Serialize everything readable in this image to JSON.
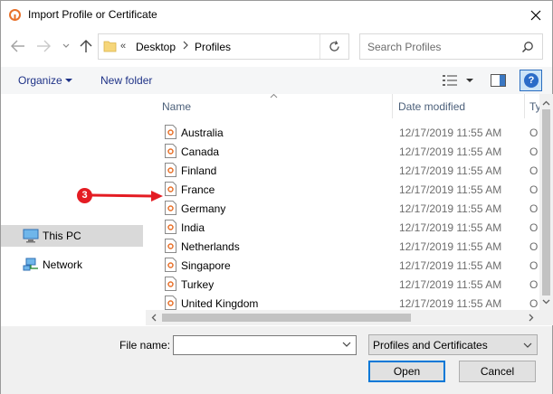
{
  "window": {
    "title": "Import Profile or Certificate"
  },
  "address": {
    "chevron": "«",
    "crumbs": [
      "Desktop",
      "Profiles"
    ]
  },
  "search": {
    "placeholder": "Search Profiles"
  },
  "toolbar": {
    "organize_label": "Organize",
    "new_folder_label": "New folder",
    "help_label": "?"
  },
  "nav": {
    "items": [
      {
        "label": "This PC",
        "selected": true
      },
      {
        "label": "Network",
        "selected": false
      }
    ]
  },
  "columns": {
    "name": "Name",
    "date": "Date modified",
    "type": "Ty"
  },
  "files": [
    {
      "name": "Australia",
      "date": "12/17/2019 11:55 AM",
      "type": "O"
    },
    {
      "name": "Canada",
      "date": "12/17/2019 11:55 AM",
      "type": "O"
    },
    {
      "name": "Finland",
      "date": "12/17/2019 11:55 AM",
      "type": "O"
    },
    {
      "name": "France",
      "date": "12/17/2019 11:55 AM",
      "type": "O"
    },
    {
      "name": "Germany",
      "date": "12/17/2019 11:55 AM",
      "type": "O"
    },
    {
      "name": "India",
      "date": "12/17/2019 11:55 AM",
      "type": "O"
    },
    {
      "name": "Netherlands",
      "date": "12/17/2019 11:55 AM",
      "type": "O"
    },
    {
      "name": "Singapore",
      "date": "12/17/2019 11:55 AM",
      "type": "O"
    },
    {
      "name": "Turkey",
      "date": "12/17/2019 11:55 AM",
      "type": "O"
    },
    {
      "name": "United Kingdom",
      "date": "12/17/2019 11:55 AM",
      "type": "O"
    }
  ],
  "bottom": {
    "file_name_label": "File name:",
    "file_name_value": "",
    "file_type_value": "Profiles and Certificates",
    "open_label": "Open",
    "cancel_label": "Cancel"
  },
  "annotation": {
    "badge": "3",
    "color": "#e41c23"
  },
  "colors": {
    "accent": "#0078d7",
    "link": "#1e3287",
    "header_text": "#4c607a"
  }
}
